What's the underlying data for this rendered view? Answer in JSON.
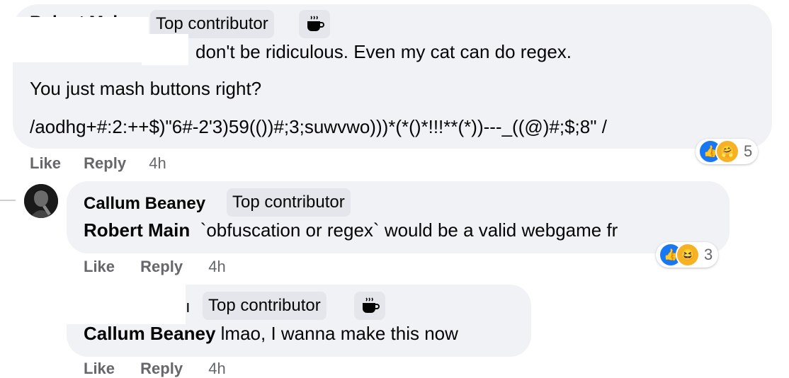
{
  "comments": [
    {
      "badge": "Top contributor",
      "lines": [
        "don't be ridiculous. Even my cat can do regex.",
        "You just mash buttons right?",
        "/aodhg+#:2:++$)\"6#-2'3)59(())#;3;suwvwo)))*(*()*!!!**(*))---_((@)#;$;8\" /"
      ],
      "like": "Like",
      "reply": "Reply",
      "time": "4h",
      "reaction_count": "5"
    },
    {
      "name": "Callum Beaney",
      "badge": "Top contributor",
      "mention": "Robert Main",
      "text": "`obfuscation or regex` would be a valid webgame fr",
      "like": "Like",
      "reply": "Reply",
      "time": "4h",
      "reaction_count": "3"
    },
    {
      "badge": "Top contributor",
      "mention": "Callum Beaney",
      "text": "lmao, I wanna make this now",
      "like": "Like",
      "reply": "Reply",
      "time": "4h"
    }
  ],
  "colors": {
    "bubble": "#f0f2f5",
    "badge": "#e4e6eb",
    "meta": "#65676b",
    "like_blue": "#1877f2",
    "emoji_yellow": "#f7b125"
  },
  "icons": {
    "badge": "coffee-cup-icon",
    "like": "thumbs-up-icon",
    "care": "care-emoji-icon",
    "haha": "laughing-emoji-icon"
  }
}
